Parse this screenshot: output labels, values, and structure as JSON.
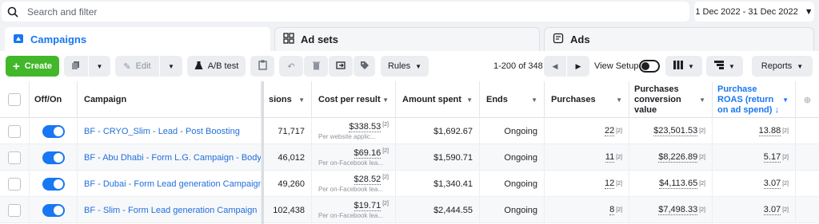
{
  "search": {
    "placeholder": "Search and filter"
  },
  "date_range": "1 Dec 2022 - 31 Dec 2022",
  "tabs": [
    {
      "label": "Campaigns"
    },
    {
      "label": "Ad sets"
    },
    {
      "label": "Ads"
    }
  ],
  "toolbar": {
    "create": "Create",
    "edit": "Edit",
    "ab_test": "A/B test",
    "rules": "Rules",
    "pagination": "1-200 of 348",
    "view_setup": "View Setup",
    "reports": "Reports"
  },
  "columns": {
    "off_on": "Off/On",
    "campaign": "Campaign",
    "impressions_partial": "sions",
    "cost_per_result": "Cost per result",
    "amount_spent": "Amount spent",
    "ends": "Ends",
    "purchases": "Purchases",
    "purchases_value": "Purchases conversion value",
    "purchase_roas": "Purchase ROAS (return on ad spend) ↓"
  },
  "rows": [
    {
      "campaign": "BF - CRYO_Slim - Lead - Post Boosting",
      "impressions": "71,717",
      "cpr": "$338.53",
      "cpr_note": "[2]",
      "cpr_sub": "Per website applic...",
      "spent": "$1,692.67",
      "ends": "Ongoing",
      "purchases": "22",
      "p_note": "[2]",
      "value": "$23,501.53",
      "v_note": "[2]",
      "roas": "13.88",
      "r_note": "[2]"
    },
    {
      "campaign": "BF - Abu Dhabi - Form L.G. Campaign - Body",
      "impressions": "46,012",
      "cpr": "$69.16",
      "cpr_note": "[2]",
      "cpr_sub": "Per on-Facebook lea...",
      "spent": "$1,590.71",
      "ends": "Ongoing",
      "purchases": "11",
      "p_note": "[2]",
      "value": "$8,226.89",
      "v_note": "[2]",
      "roas": "5.17",
      "r_note": "[2]"
    },
    {
      "campaign": "BF - Dubai - Form Lead generation Campaign ...",
      "impressions": "49,260",
      "cpr": "$28.52",
      "cpr_note": "[2]",
      "cpr_sub": "Per on-Facebook lea...",
      "spent": "$1,340.41",
      "ends": "Ongoing",
      "purchases": "12",
      "p_note": "[2]",
      "value": "$4,113.65",
      "v_note": "[2]",
      "roas": "3.07",
      "r_note": "[2]"
    },
    {
      "campaign": "BF - Slim - Form Lead generation Campaign",
      "impressions": "102,438",
      "cpr": "$19.71",
      "cpr_note": "[2]",
      "cpr_sub": "Per on-Facebook lea...",
      "spent": "$2,444.55",
      "ends": "Ongoing",
      "purchases": "8",
      "p_note": "[2]",
      "value": "$7,498.33",
      "v_note": "[2]",
      "roas": "3.07",
      "r_note": "[2]"
    }
  ],
  "colors": {
    "accent": "#1877f2",
    "create_green": "#42b72a",
    "link": "#216fdb"
  }
}
